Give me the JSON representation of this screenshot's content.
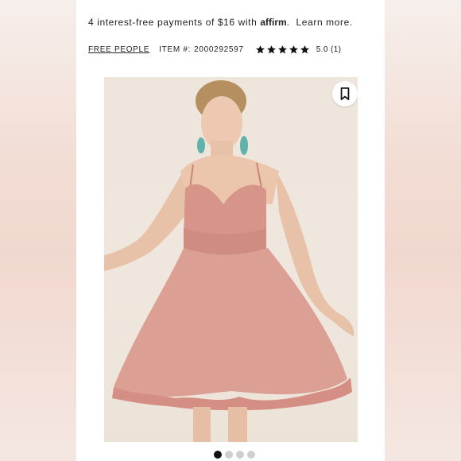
{
  "payment": {
    "prefix": "4 interest-free payments of $16 with",
    "provider": "affirm",
    "suffix": ".",
    "learn_more": "Learn more."
  },
  "product": {
    "brand": "FREE PEOPLE",
    "item_label": "ITEM #:",
    "item_number": "2000292597",
    "rating_stars": 5,
    "rating_text": "5.0 (1)"
  },
  "gallery": {
    "image_count": 4,
    "active_index": 0,
    "bookmark_icon": "bookmark-icon"
  }
}
